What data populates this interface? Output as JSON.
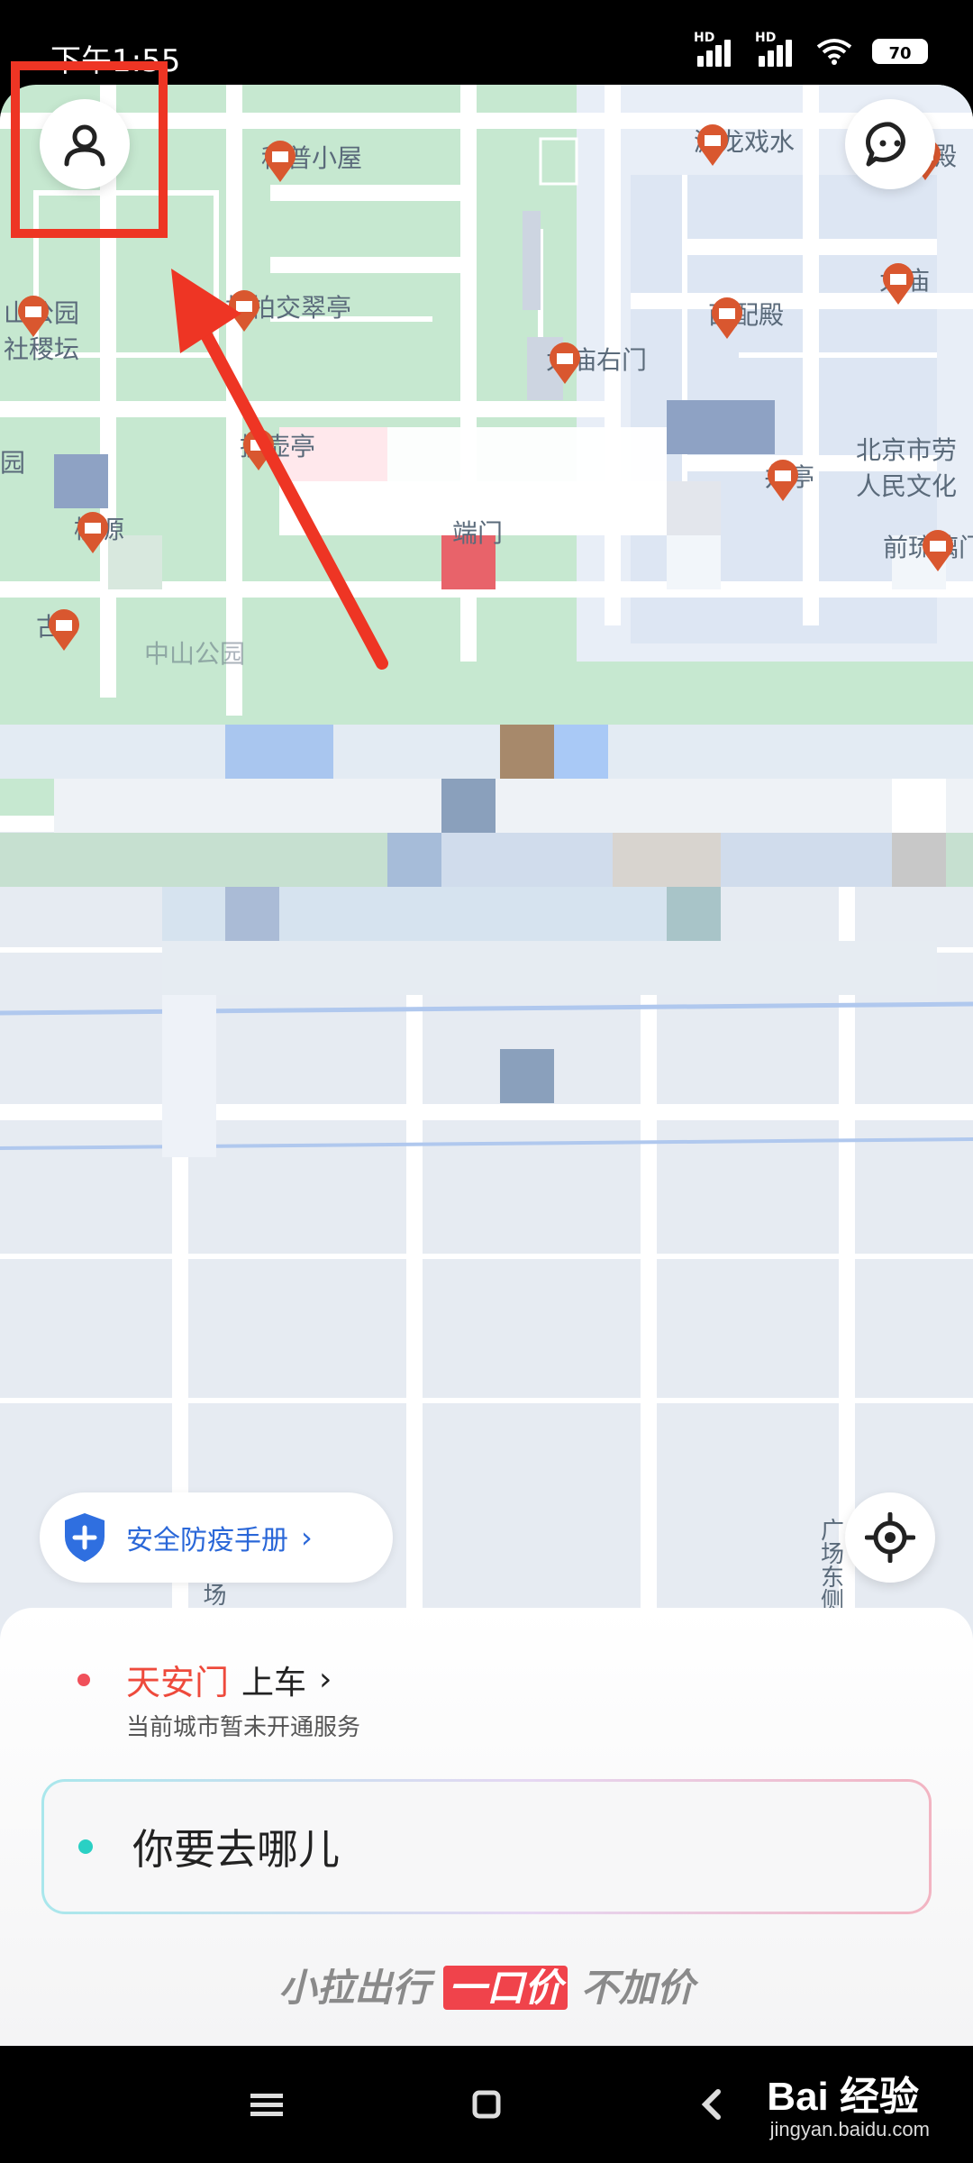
{
  "status_bar": {
    "time": "下午1:55",
    "network_labels": [
      "HD",
      "HD"
    ],
    "battery": "70"
  },
  "map": {
    "pois": [
      {
        "label": "科普小屋"
      },
      {
        "label": "游龙戏水"
      },
      {
        "label": "中殿"
      },
      {
        "label": "松柏交翠亭"
      },
      {
        "label": "太庙"
      },
      {
        "label": "西配殿"
      },
      {
        "label": "太庙右门"
      },
      {
        "label": "山公园"
      },
      {
        "label": "社稷坛"
      },
      {
        "label": "北京市劳"
      },
      {
        "label": "人民文化"
      },
      {
        "label": "投壶亭"
      },
      {
        "label": "端门"
      },
      {
        "label": "井亭"
      },
      {
        "label": "桃源"
      },
      {
        "label": "前琉璃门"
      },
      {
        "label": "园"
      },
      {
        "label": "古"
      },
      {
        "label": "中山公园"
      },
      {
        "label": "广场东侧"
      },
      {
        "label": "场"
      }
    ]
  },
  "controls": {
    "profile_icon": "user-icon",
    "message_icon": "chat-icon",
    "locate_icon": "locate-icon"
  },
  "safety_chip": {
    "label": "安全防疫手册",
    "icon": "shield-plus-icon"
  },
  "booking": {
    "pickup_place": "天安门",
    "pickup_suffix": "上车",
    "service_note": "当前城市暂未开通服务",
    "destination_placeholder": "你要去哪儿"
  },
  "slogan": {
    "prefix": "小拉出行",
    "highlight": "一口价",
    "suffix": "不加价"
  },
  "watermark": {
    "brand": "Bai 经验",
    "url": "jingyan.baidu.com"
  },
  "colors": {
    "accent_red": "#ee4a3c",
    "map_green": "#c6e8d0",
    "highlight_red": "#ee3524",
    "link_blue": "#2a67d8"
  }
}
